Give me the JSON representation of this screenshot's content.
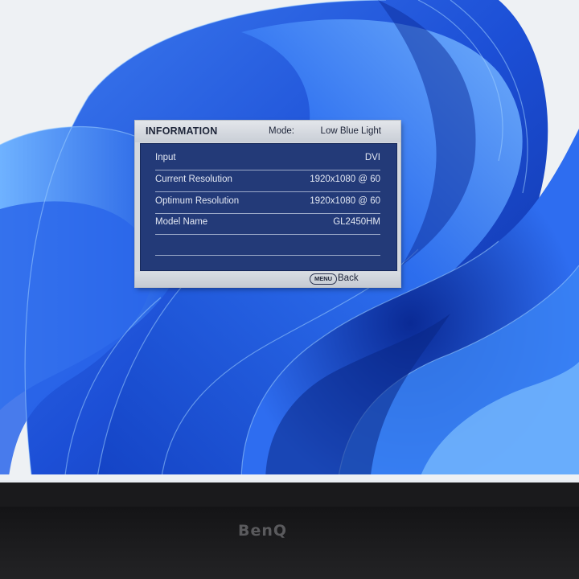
{
  "osd": {
    "title": "INFORMATION",
    "mode_label": "Mode:",
    "mode_value": "Low Blue Light",
    "rows": [
      {
        "label": "Input",
        "value": "DVI"
      },
      {
        "label": "Current Resolution",
        "value": "1920x1080 @ 60"
      },
      {
        "label": "Optimum Resolution",
        "value": "1920x1080 @ 60"
      },
      {
        "label": "Model Name",
        "value": "GL2450HM"
      }
    ],
    "menu_key": "MENU",
    "back_label": "Back"
  },
  "taskbar": {
    "icons": [
      "start-icon",
      "copilot-icon",
      "task-view-icon",
      "file-explorer-icon",
      "edge-icon",
      "store-icon",
      "settings-icon"
    ]
  },
  "monitor": {
    "brand": "BenQ"
  },
  "colors": {
    "osd_panel": "#233a78",
    "osd_header": "#d4d8de",
    "wallpaper_blue": "#1f5fe0",
    "taskbar": "#e9edf2"
  }
}
